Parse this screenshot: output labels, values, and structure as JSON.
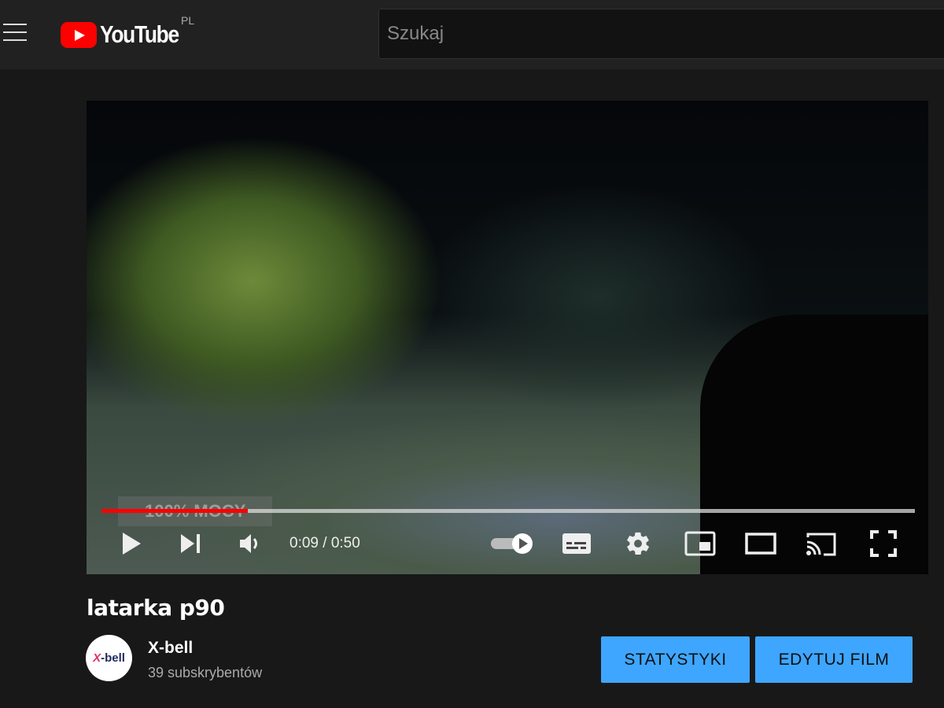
{
  "header": {
    "logo_text": "YouTube",
    "region": "PL",
    "search_placeholder": "Szukaj"
  },
  "player": {
    "overlay_text": "100% MOCY",
    "current_time": "0:09",
    "duration": "0:50",
    "time_display": "0:09 / 0:50",
    "progress_percent": 18,
    "autoplay": true
  },
  "video": {
    "title": "latarka p90"
  },
  "channel": {
    "name": "X-bell",
    "avatar_text": "X-bell",
    "subscribers": "39 subskrybentów"
  },
  "buttons": {
    "stats": "STATYSTYKI",
    "edit": "EDYTUJ FILM"
  },
  "colors": {
    "accent": "#3ea6ff",
    "progress": "#ff0000",
    "logo": "#ff0000"
  }
}
